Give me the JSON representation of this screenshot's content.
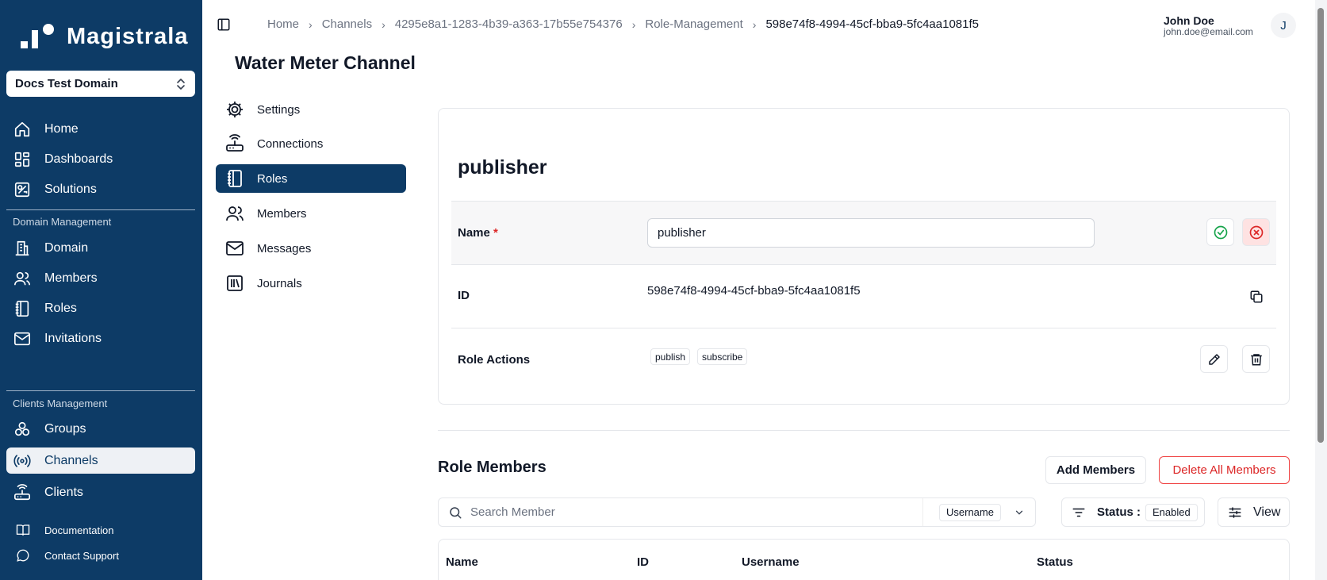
{
  "brand": {
    "name": "Magistrala"
  },
  "domain_select": {
    "value": "Docs Test Domain"
  },
  "sidebar": {
    "primary": [
      {
        "label": "Home",
        "icon": "home-icon"
      },
      {
        "label": "Dashboards",
        "icon": "dashboard-icon"
      },
      {
        "label": "Solutions",
        "icon": "solutions-icon"
      }
    ],
    "domain_section": "Domain Management",
    "domain_items": [
      {
        "label": "Domain",
        "icon": "building-icon"
      },
      {
        "label": "Members",
        "icon": "users-icon"
      },
      {
        "label": "Roles",
        "icon": "notebook-icon"
      },
      {
        "label": "Invitations",
        "icon": "mail-icon"
      }
    ],
    "clients_section": "Clients Management",
    "clients_items": [
      {
        "label": "Groups",
        "icon": "groups-icon"
      },
      {
        "label": "Channels",
        "icon": "radio-icon",
        "active": true
      },
      {
        "label": "Clients",
        "icon": "router-icon"
      }
    ],
    "footer_items": [
      {
        "label": "Documentation",
        "icon": "book-icon"
      },
      {
        "label": "Contact Support",
        "icon": "chat-icon"
      }
    ]
  },
  "breadcrumb": [
    "Home",
    "Channels",
    "4295e8a1-1283-4b39-a363-17b55e754376",
    "Role-Management",
    "598e74f8-4994-45cf-bba9-5fc4aa1081f5"
  ],
  "user": {
    "name": "John Doe",
    "email": "john.doe@email.com",
    "initial": "J"
  },
  "page_title": "Water Meter Channel",
  "subnav": [
    {
      "label": "Settings",
      "icon": "settings-icon"
    },
    {
      "label": "Connections",
      "icon": "router-icon"
    },
    {
      "label": "Roles",
      "icon": "notebook-icon",
      "active": true
    },
    {
      "label": "Members",
      "icon": "users-icon"
    },
    {
      "label": "Messages",
      "icon": "mail-icon"
    },
    {
      "label": "Journals",
      "icon": "library-icon"
    }
  ],
  "role": {
    "title": "publisher",
    "name_label": "Name",
    "required_mark": "*",
    "name_value": "publisher",
    "id_label": "ID",
    "id_value": "598e74f8-4994-45cf-bba9-5fc4aa1081f5",
    "actions_label": "Role Actions",
    "actions": [
      "publish",
      "subscribe"
    ]
  },
  "role_members": {
    "title": "Role Members",
    "add_button": "Add Members",
    "delete_button": "Delete All Members",
    "search_placeholder": "Search Member",
    "search_filter": "Username",
    "status_label": "Status :",
    "status_value": "Enabled",
    "view_button": "View",
    "columns": [
      "Name",
      "ID",
      "Username",
      "Status"
    ]
  },
  "colors": {
    "sidebar": "#0d3b66",
    "accent": "#0d3b66",
    "confirm": "#16a34a",
    "cancel": "#dc2626"
  }
}
